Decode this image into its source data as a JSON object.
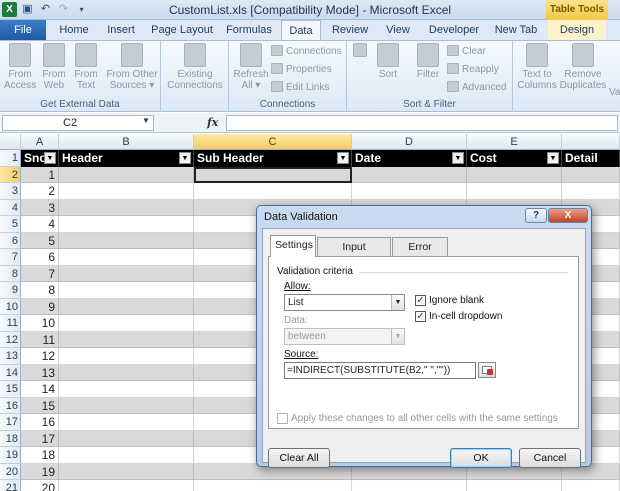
{
  "window": {
    "title": "CustomList.xls  [Compatibility Mode]  -  Microsoft Excel",
    "context_tab": "Table Tools"
  },
  "ribbon_tabs": [
    "File",
    "Home",
    "Insert",
    "Page Layout",
    "Formulas",
    "Data",
    "Review",
    "View",
    "Developer",
    "New Tab",
    "Design"
  ],
  "active_tab": "Data",
  "ribbon": {
    "get_external": {
      "label": "Get External Data",
      "from_access": "From\nAccess",
      "from_web": "From\nWeb",
      "from_text": "From\nText",
      "from_other": "From Other\nSources ▾",
      "existing": "Existing\nConnections"
    },
    "connections": {
      "label": "Connections",
      "refresh_all": "Refresh\nAll ▾",
      "connections": "Connections",
      "properties": "Properties",
      "edit_links": "Edit Links"
    },
    "sort_filter": {
      "label": "Sort & Filter",
      "sort": "Sort",
      "filter": "Filter",
      "clear": "Clear",
      "reapply": "Reapply",
      "advanced": "Advanced"
    },
    "data_tools": {
      "text_to_columns": "Text to\nColumns",
      "remove_duplicates": "Remove\nDuplicates",
      "validation_partial": "Va"
    }
  },
  "formula_bar": {
    "name_box": "C2",
    "fx": "fx",
    "formula": ""
  },
  "columns": [
    "A",
    "B",
    "C",
    "D",
    "E"
  ],
  "selected_column": "C",
  "header_row": {
    "row": "1",
    "cells": [
      "Sno",
      "Header",
      "Sub Header",
      "Date",
      "Cost",
      "Detail"
    ]
  },
  "rows": [
    {
      "row": "2",
      "sno": "1"
    },
    {
      "row": "3",
      "sno": "2"
    },
    {
      "row": "4",
      "sno": "3"
    },
    {
      "row": "5",
      "sno": "4"
    },
    {
      "row": "6",
      "sno": "5"
    },
    {
      "row": "7",
      "sno": "6"
    },
    {
      "row": "8",
      "sno": "7"
    },
    {
      "row": "9",
      "sno": "8"
    },
    {
      "row": "10",
      "sno": "9"
    },
    {
      "row": "11",
      "sno": "10"
    },
    {
      "row": "12",
      "sno": "11"
    },
    {
      "row": "13",
      "sno": "12"
    },
    {
      "row": "14",
      "sno": "13"
    },
    {
      "row": "15",
      "sno": "14"
    },
    {
      "row": "16",
      "sno": "15"
    },
    {
      "row": "17",
      "sno": "16"
    },
    {
      "row": "18",
      "sno": "17"
    },
    {
      "row": "19",
      "sno": "18"
    },
    {
      "row": "20",
      "sno": "19"
    },
    {
      "row": "21",
      "sno": "20"
    }
  ],
  "selected_row": "2",
  "dialog": {
    "title": "Data Validation",
    "help": "?",
    "close": "X",
    "tabs": [
      "Settings",
      "Input Message",
      "Error Alert"
    ],
    "active_tab": "Settings",
    "section_label": "Validation criteria",
    "allow_label": "Allow:",
    "allow_value": "List",
    "data_label": "Data:",
    "data_value": "between",
    "ignore_blank_label": "Ignore blank",
    "ignore_blank_checked": true,
    "in_cell_dropdown_label": "In-cell dropdown",
    "in_cell_dropdown_checked": true,
    "source_label": "Source:",
    "source_value": "=INDIRECT(SUBSTITUTE(B2,\" \",\"\"))",
    "apply_all_label": "Apply these changes to all other cells with the same settings",
    "clear_all": "Clear All",
    "ok": "OK",
    "cancel": "Cancel"
  }
}
